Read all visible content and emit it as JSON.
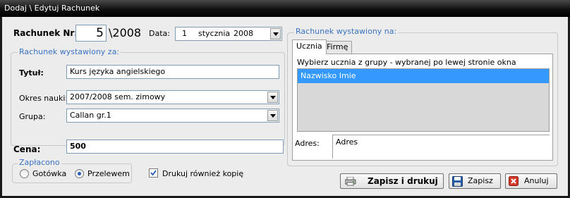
{
  "window": {
    "title": "Dodaj \\ Edytuj Rachunek"
  },
  "invoice": {
    "number_label": "Rachunek Nr:",
    "number_value": "5",
    "number_suffix": "\\2008",
    "date_label": "Data:",
    "date_day": "1",
    "date_month": "stycznia",
    "date_year": "2008"
  },
  "issued_for": {
    "legend": "Rachunek wystawiony za:",
    "title_label": "Tytuł:",
    "title_value": "Kurs języka angielskiego",
    "period_label": "Okres nauki:",
    "period_value": "2007/2008 sem. zimowy",
    "group_label": "Grupa:",
    "group_value": "Callan gr.1"
  },
  "price": {
    "label": "Cena:",
    "value": "500"
  },
  "paid": {
    "legend": "Zapłacono",
    "cash_label": "Gotówka",
    "transfer_label": "Przelewem",
    "selected": "transfer"
  },
  "print_copy": {
    "label": "Drukuj również kopię",
    "checked": true
  },
  "issued_to": {
    "legend": "Rachunek wystawiony na:",
    "tabs": [
      {
        "label": "Ucznia",
        "active": true
      },
      {
        "label": "Firmę",
        "active": false
      }
    ],
    "hint": "Wybierz ucznia z grupy - wybranej po lewej stronie okna",
    "list": [
      {
        "label": "Nazwisko Imie",
        "selected": true
      }
    ],
    "address_label": "Adres:",
    "address_value": "Adres"
  },
  "buttons": {
    "save_print": "Zapisz i drukuj",
    "save": "Zapisz",
    "cancel": "Anuluj"
  },
  "colors": {
    "selection": "#3399ff",
    "legend": "#3a73c2",
    "titlebar": "#000000"
  }
}
